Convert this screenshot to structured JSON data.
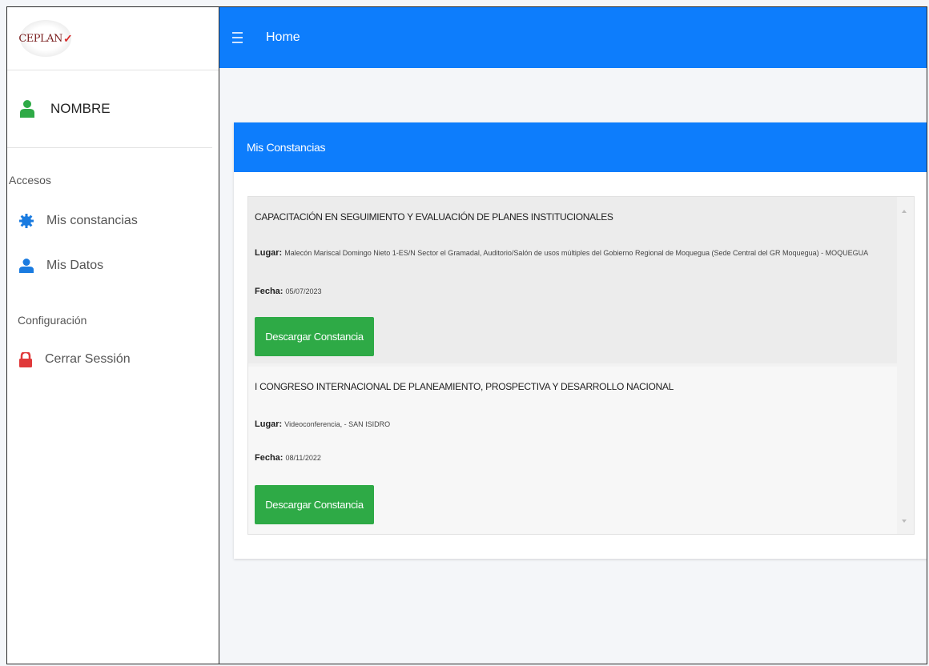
{
  "logo": {
    "text": "CEPLAN"
  },
  "user": {
    "name": "NOMBRE"
  },
  "sidebar": {
    "section_access": "Accesos",
    "items": [
      {
        "label": "Mis constancias",
        "icon": "gear-icon"
      },
      {
        "label": "Mis Datos",
        "icon": "user-icon"
      }
    ],
    "section_config": "Configuración",
    "logout": {
      "label": "Cerrar Sessión",
      "icon": "lock-icon"
    }
  },
  "topbar": {
    "title": "Home",
    "menu_icon": "hamburger-icon"
  },
  "card": {
    "title": "Mis Constancias",
    "items": [
      {
        "title": "CAPACITACIÓN EN SEGUIMIENTO Y EVALUACIÓN DE PLANES INSTITUCIONALES",
        "lugar_label": "Lugar:",
        "lugar": "Malecón Mariscal Domingo Nieto 1-ES/N Sector el Gramadal, Auditorio/Salón de usos múltiples del Gobierno Regional de Moquegua (Sede Central del GR Moquegua) - MOQUEGUA",
        "fecha_label": "Fecha:",
        "fecha": "05/07/2023",
        "button": "Descargar Constancia"
      },
      {
        "title": "I CONGRESO INTERNACIONAL DE PLANEAMIENTO, PROSPECTIVA Y DESARROLLO NACIONAL",
        "lugar_label": "Lugar:",
        "lugar": "Videoconferencia, - SAN ISIDRO",
        "fecha_label": "Fecha:",
        "fecha": "08/11/2022",
        "button": "Descargar Constancia"
      }
    ]
  },
  "colors": {
    "primary": "#0d7dfc",
    "success": "#2eaa46",
    "user_icon_green": "#2eaa46",
    "user_icon_blue": "#1a7be0",
    "lock": "#e0393a"
  }
}
